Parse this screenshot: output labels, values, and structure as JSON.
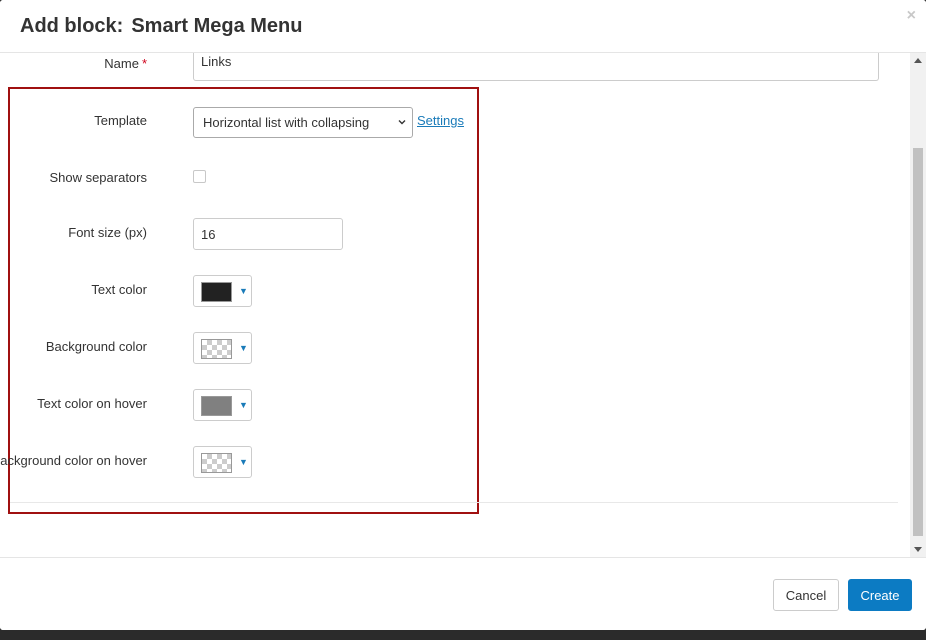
{
  "header": {
    "title_prefix": "Add block:",
    "title_name": "Smart Mega Menu",
    "close_glyph": "×"
  },
  "form": {
    "name": {
      "label": "Name",
      "required_mark": "*",
      "value": "Links"
    },
    "template": {
      "label": "Template",
      "selected": "Horizontal list with collapsing",
      "settings_link": "Settings"
    },
    "show_separators": {
      "label": "Show separators",
      "checked": false
    },
    "font_size": {
      "label": "Font size (px)",
      "value": "16"
    },
    "text_color": {
      "label": "Text color",
      "color": "#222222"
    },
    "background_color": {
      "label": "Background color",
      "color": "transparent"
    },
    "text_color_hover": {
      "label": "Text color on hover",
      "color": "#808080"
    },
    "background_color_hover": {
      "label": "Background color on hover",
      "color": "transparent"
    }
  },
  "icons": {
    "dropdown_caret": "▼"
  },
  "footer": {
    "cancel_label": "Cancel",
    "create_label": "Create"
  },
  "colors": {
    "accent": "#0c7bc3",
    "highlight_border": "#a01010",
    "required": "#d0021b"
  }
}
